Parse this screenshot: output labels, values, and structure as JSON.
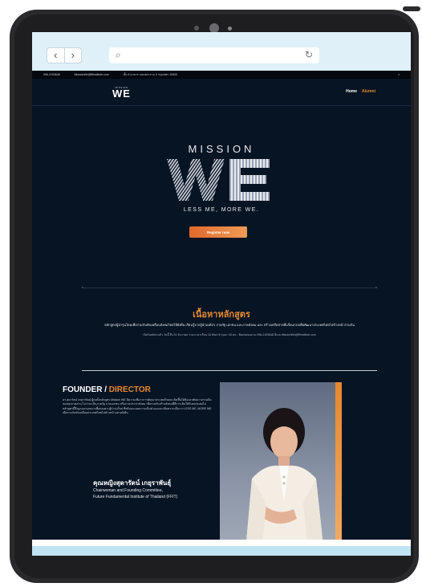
{
  "browser": {
    "back_icon": "chevron-left-icon",
    "forward_icon": "chevron-right-icon",
    "search_icon": "search-icon",
    "reload_icon": "reload-icon"
  },
  "topbar": {
    "phone": "096-2193648",
    "email": "MissionWe@fftinstitute.com",
    "address": "ชั้น 6 อาคาร ถนนพระราม 4 กรุงเทพฯ 10500",
    "extra": "≡"
  },
  "header": {
    "logo_small": "MISSION",
    "logo_big": "WE",
    "menu": [
      {
        "label": "Home",
        "active": false
      },
      {
        "label": "Alumni",
        "active": true
      }
    ]
  },
  "hero": {
    "mission": "MISSION",
    "we": "WE",
    "slogan": "LESS ME, MORE WE.",
    "register_label": "Register now"
  },
  "content": {
    "title": "เนื้อหาหลักสูตร",
    "description": "หลักสูตรผู้นำรุ่นใหม่เพื่อร่วมกันขับเคลื่อนสังคมไทยให้ยั่งยืน เรียนรู้จากผู้นำองค์กร ภาครัฐ เอกชน และภาคสังคม และ สร้างเครือข่ายที่แข็งแกร่งเพื่อพัฒนาประเทศไทยไปข้างหน้าร่วมกัน",
    "info": "เปิดรับสมัครแล้ว วันนี้ ถึง 31 ธันวาคม ระยะเวลาเรียน 16 สัปดาห์ รุ่นละ 40 คน · ติดต่อสอบถาม 096-2193648 อีเมล MissionWe@fftinstitute.com"
  },
  "founder": {
    "heading_a": "FOUNDER",
    "heading_sep": " / ",
    "heading_b": "DIRECTOR",
    "bio_1": "ดร.สุดารัตน์ เกยุราพันธุ์ ผู้ก่อตั้งหลักสูตร Mission WE มีความเชื่อว่าการพัฒนาประเทศไทยจะเกิดขึ้นได้ต้องอาศัยความร่วมมือของทุกภาคส่วน ไม่ว่าจะเป็นภาครัฐ ภาคเอกชน หรือภาคประชาสังคม เพื่อร่วมกันสร้างสังคมที่ดีกว่าเดิมให้กับคนรุ่นต่อไป",
    "bio_2": "หลักสูตรนี้จึงถูกออกแบบมาเพื่อบ่มเพาะผู้นำรุ่นใหม่ ที่พร้อมจะลดความเป็นตัวเองและเพิ่มความเป็นเรา LESS ME, MORE WE เพื่อร่วมกันขับเคลื่อนประเทศไทยไปข้างหน้าอย่างยั่งยืน",
    "name": "คุณหญิงสุดารัตน์ เกยุราพันธุ์",
    "role_1": "Chairwoman and Founding Committee,",
    "role_2": "Future Fundamental Institute of Thailand (FFIT)"
  }
}
